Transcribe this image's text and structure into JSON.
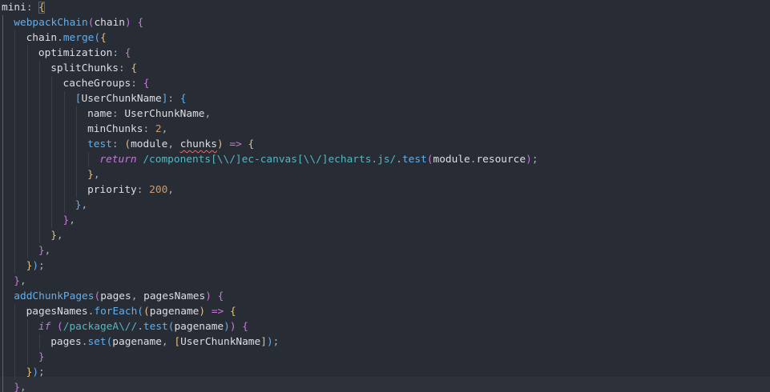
{
  "editor": {
    "language": "javascript",
    "theme": "dark",
    "colors": {
      "background": "#282c34",
      "text": "#abb2bf",
      "function": "#61afef",
      "number": "#d19a66",
      "keyword": "#c678dd",
      "regex": "#56b6c2",
      "squiggle": "#e06c75"
    },
    "lines": [
      [
        [
          "mini",
          "t-white"
        ],
        [
          ":",
          "t-punc"
        ],
        [
          " ",
          ""
        ],
        [
          "{",
          "t-br1"
        ]
      ],
      [
        [
          "webpackChain",
          "t-fn"
        ],
        [
          "(",
          "t-br2"
        ],
        [
          "chain",
          "t-white"
        ],
        [
          ")",
          "t-br2"
        ],
        [
          " ",
          ""
        ],
        [
          "{",
          "t-br2"
        ]
      ],
      [
        [
          "chain",
          "t-white"
        ],
        [
          ".",
          "t-punc"
        ],
        [
          "merge",
          "t-fn"
        ],
        [
          "(",
          "t-br3"
        ],
        [
          "{",
          "t-br1"
        ]
      ],
      [
        [
          "optimization",
          "t-white"
        ],
        [
          ":",
          "t-punc"
        ],
        [
          " ",
          ""
        ],
        [
          "{",
          "t-br2"
        ]
      ],
      [
        [
          "splitChunks",
          "t-white"
        ],
        [
          ":",
          "t-punc"
        ],
        [
          " ",
          ""
        ],
        [
          "{",
          "t-br1"
        ]
      ],
      [
        [
          "cacheGroups",
          "t-white"
        ],
        [
          ":",
          "t-punc"
        ],
        [
          " ",
          ""
        ],
        [
          "{",
          "t-br2"
        ]
      ],
      [
        [
          "[",
          "t-br3"
        ],
        [
          "UserChunkName",
          "t-white"
        ],
        [
          "]",
          "t-br3"
        ],
        [
          ":",
          "t-punc"
        ],
        [
          " ",
          ""
        ],
        [
          "{",
          "t-br3"
        ]
      ],
      [
        [
          "name",
          "t-white"
        ],
        [
          ":",
          "t-punc"
        ],
        [
          " UserChunkName",
          "t-white"
        ],
        [
          ",",
          "t-punc"
        ]
      ],
      [
        [
          "minChunks",
          "t-white"
        ],
        [
          ":",
          "t-punc"
        ],
        [
          " ",
          ""
        ],
        [
          "2",
          "t-num"
        ],
        [
          ",",
          "t-punc"
        ]
      ],
      [
        [
          "test",
          "t-fn"
        ],
        [
          ":",
          "t-punc"
        ],
        [
          " ",
          ""
        ],
        [
          "(",
          "t-br1"
        ],
        [
          "module",
          "t-white"
        ],
        [
          ", ",
          "t-punc"
        ],
        [
          "chunks",
          "t-white t-squig"
        ],
        [
          ")",
          "t-br1"
        ],
        [
          " ",
          ""
        ],
        [
          "=>",
          "t-arrow"
        ],
        [
          " ",
          ""
        ],
        [
          "{",
          "t-br1"
        ]
      ],
      [
        [
          "return",
          "t-kw"
        ],
        [
          " ",
          ""
        ],
        [
          "/components[\\\\/]ec-canvas[\\\\/]echarts.js/",
          "t-regex"
        ],
        [
          ".",
          "t-punc"
        ],
        [
          "test",
          "t-fn"
        ],
        [
          "(",
          "t-br2"
        ],
        [
          "module",
          "t-white"
        ],
        [
          ".",
          "t-punc"
        ],
        [
          "resource",
          "t-white"
        ],
        [
          ")",
          "t-br2"
        ],
        [
          ";",
          "t-punc"
        ]
      ],
      [
        [
          "}",
          "t-br1"
        ],
        [
          ",",
          "t-punc"
        ]
      ],
      [
        [
          "priority",
          "t-white"
        ],
        [
          ":",
          "t-punc"
        ],
        [
          " ",
          ""
        ],
        [
          "200",
          "t-num"
        ],
        [
          ",",
          "t-punc"
        ]
      ],
      [
        [
          "}",
          "t-br3"
        ],
        [
          ",",
          "t-punc"
        ]
      ],
      [
        [
          "}",
          "t-br2"
        ],
        [
          ",",
          "t-punc"
        ]
      ],
      [
        [
          "}",
          "t-br1"
        ],
        [
          ",",
          "t-punc"
        ]
      ],
      [
        [
          "}",
          "t-br2"
        ],
        [
          ",",
          "t-punc"
        ]
      ],
      [
        [
          "}",
          "t-br1"
        ],
        [
          ")",
          "t-br3"
        ],
        [
          ";",
          "t-punc"
        ]
      ],
      [
        [
          "}",
          "t-br2"
        ],
        [
          ",",
          "t-punc"
        ]
      ],
      [
        [
          "addChunkPages",
          "t-fn"
        ],
        [
          "(",
          "t-br2"
        ],
        [
          "pages",
          "t-white"
        ],
        [
          ", ",
          "t-punc"
        ],
        [
          "pagesNames",
          "t-white"
        ],
        [
          ")",
          "t-br2"
        ],
        [
          " ",
          ""
        ],
        [
          "{",
          "t-br2"
        ]
      ],
      [
        [
          "pagesNames",
          "t-white"
        ],
        [
          ".",
          "t-punc"
        ],
        [
          "forEach",
          "t-fn"
        ],
        [
          "(",
          "t-br3"
        ],
        [
          "(",
          "t-br1"
        ],
        [
          "pagename",
          "t-white"
        ],
        [
          ")",
          "t-br1"
        ],
        [
          " ",
          ""
        ],
        [
          "=>",
          "t-arrow"
        ],
        [
          " ",
          ""
        ],
        [
          "{",
          "t-br1"
        ]
      ],
      [
        [
          "if",
          "t-kw"
        ],
        [
          " ",
          ""
        ],
        [
          "(",
          "t-br2"
        ],
        [
          "/packageA\\//",
          "t-regex"
        ],
        [
          ".",
          "t-punc"
        ],
        [
          "test",
          "t-fn"
        ],
        [
          "(",
          "t-br3"
        ],
        [
          "pagename",
          "t-white"
        ],
        [
          ")",
          "t-br3"
        ],
        [
          ")",
          "t-br2"
        ],
        [
          " ",
          ""
        ],
        [
          "{",
          "t-br2"
        ]
      ],
      [
        [
          "pages",
          "t-white"
        ],
        [
          ".",
          "t-punc"
        ],
        [
          "set",
          "t-fn"
        ],
        [
          "(",
          "t-br3"
        ],
        [
          "pagename",
          "t-white"
        ],
        [
          ", ",
          "t-punc"
        ],
        [
          "[",
          "t-br1"
        ],
        [
          "UserChunkName",
          "t-white"
        ],
        [
          "]",
          "t-br1"
        ],
        [
          ")",
          "t-br3"
        ],
        [
          ";",
          "t-punc"
        ]
      ],
      [
        [
          "}",
          "t-br2"
        ]
      ],
      [
        [
          "}",
          "t-br1"
        ],
        [
          ")",
          "t-br3"
        ],
        [
          ";",
          "t-punc"
        ]
      ],
      [
        [
          "}",
          "t-br2"
        ],
        [
          ",",
          "t-punc"
        ]
      ]
    ]
  }
}
